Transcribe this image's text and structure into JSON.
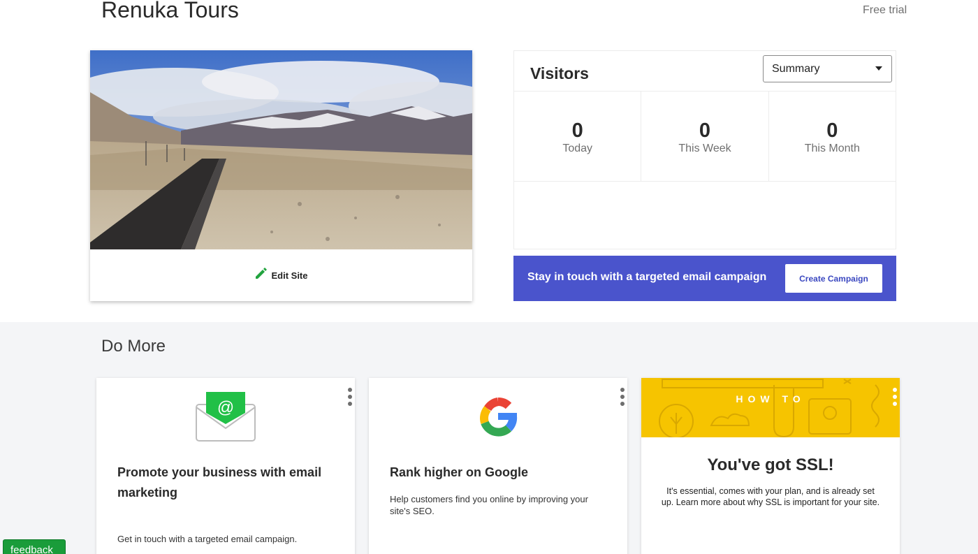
{
  "header": {
    "site_title": "Renuka Tours",
    "free_trial_label": "Free trial"
  },
  "site_card": {
    "edit_label": "Edit Site",
    "image_alt": "Mountain road landscape"
  },
  "visitors": {
    "title": "Visitors",
    "select_value": "Summary",
    "stats": [
      {
        "value": "0",
        "label": "Today"
      },
      {
        "value": "0",
        "label": "This Week"
      },
      {
        "value": "0",
        "label": "This Month"
      }
    ]
  },
  "campaign": {
    "text": "Stay in touch with a targeted email campaign",
    "button_label": "Create Campaign",
    "color": "#4a54cc"
  },
  "do_more": {
    "title": "Do More",
    "cards": [
      {
        "icon": "email-envelope-icon",
        "title": "Promote your business with email marketing",
        "description": "Get in touch with a targeted email campaign."
      },
      {
        "icon": "google-icon",
        "title": "Rank higher on Google",
        "description": "Help customers find you online by improving your site's SEO."
      },
      {
        "banner_label": "HOW TO",
        "title": "You've got SSL!",
        "description": "It's essential, comes with your plan, and is already set up. Learn more about why SSL is important for your site."
      }
    ]
  },
  "feedback": {
    "label": "feedback"
  }
}
